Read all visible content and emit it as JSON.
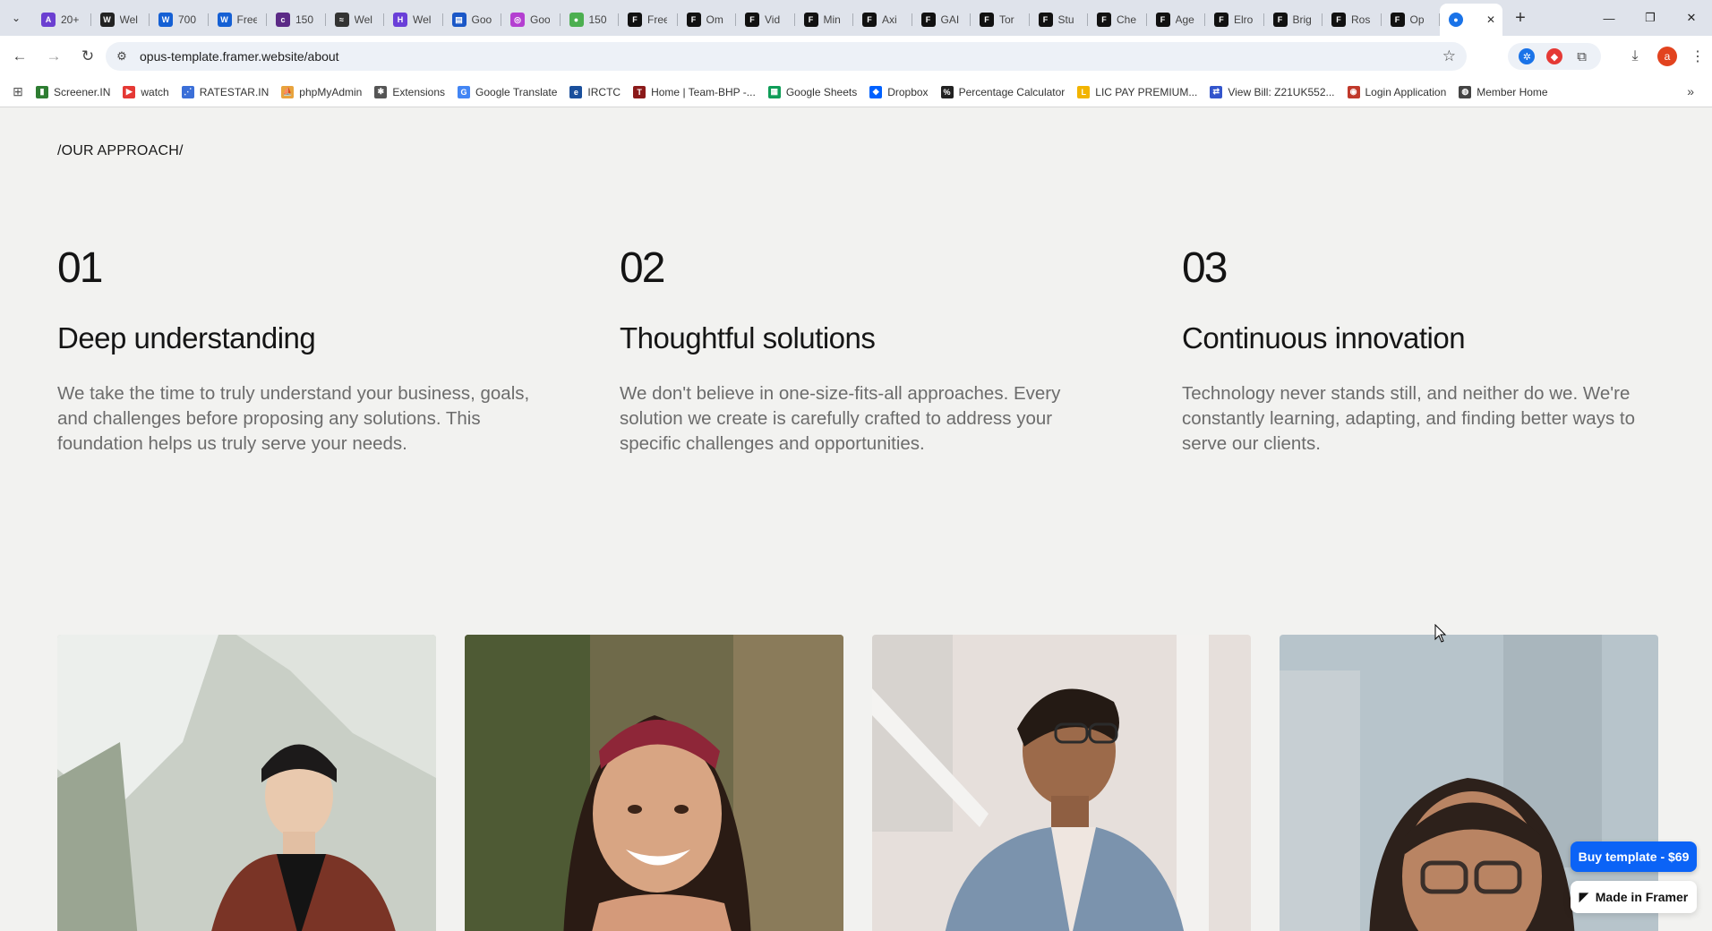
{
  "browser": {
    "tabs": [
      {
        "title": "20+",
        "color": "#6b3fd1",
        "glyph": "A"
      },
      {
        "title": "Wel",
        "color": "#222222",
        "glyph": "W"
      },
      {
        "title": "700",
        "color": "#1560d4",
        "glyph": "W"
      },
      {
        "title": "Free",
        "color": "#1560d4",
        "glyph": "W"
      },
      {
        "title": "150",
        "color": "#5b2a86",
        "glyph": "c"
      },
      {
        "title": "Wel",
        "color": "#333333",
        "glyph": "≈"
      },
      {
        "title": "Wel",
        "color": "#6a3fd8",
        "glyph": "H"
      },
      {
        "title": "Goo",
        "color": "#1a57c7",
        "glyph": "▤"
      },
      {
        "title": "Goo",
        "color": "#b43fd1",
        "glyph": "◎"
      },
      {
        "title": "150",
        "color": "#4caf50",
        "glyph": "●"
      },
      {
        "title": "Free",
        "color": "#111111",
        "glyph": "F"
      },
      {
        "title": "Om",
        "color": "#111111",
        "glyph": "F"
      },
      {
        "title": "Vid",
        "color": "#111111",
        "glyph": "F"
      },
      {
        "title": "Min",
        "color": "#111111",
        "glyph": "F"
      },
      {
        "title": "Axi",
        "color": "#111111",
        "glyph": "F"
      },
      {
        "title": "GAI",
        "color": "#111111",
        "glyph": "F"
      },
      {
        "title": "Tor",
        "color": "#111111",
        "glyph": "F"
      },
      {
        "title": "Stu",
        "color": "#111111",
        "glyph": "F"
      },
      {
        "title": "Che",
        "color": "#111111",
        "glyph": "F"
      },
      {
        "title": "Age",
        "color": "#111111",
        "glyph": "F"
      },
      {
        "title": "Elro",
        "color": "#111111",
        "glyph": "F"
      },
      {
        "title": "Brig",
        "color": "#111111",
        "glyph": "F"
      },
      {
        "title": "Ros",
        "color": "#111111",
        "glyph": "F"
      },
      {
        "title": "Op",
        "color": "#111111",
        "glyph": "F"
      }
    ],
    "active_tab": {
      "glyph": "●",
      "color": "#1a73e8"
    },
    "url": "opus-template.framer.website/about",
    "profile_initial": "a",
    "bookmarks": [
      {
        "label": "Screener.IN",
        "color": "#2e7d32",
        "glyph": "▮"
      },
      {
        "label": "watch",
        "color": "#e53935",
        "glyph": "▶"
      },
      {
        "label": "RATESTAR.IN",
        "color": "#3b6fd8",
        "glyph": "⋰"
      },
      {
        "label": "phpMyAdmin",
        "color": "#e8a33d",
        "glyph": "⛵"
      },
      {
        "label": "Extensions",
        "color": "#555555",
        "glyph": "✱"
      },
      {
        "label": "Google Translate",
        "color": "#4285f4",
        "glyph": "G"
      },
      {
        "label": "IRCTC",
        "color": "#1a4f9c",
        "glyph": "e"
      },
      {
        "label": "Home | Team-BHP -...",
        "color": "#8b1a1a",
        "glyph": "T"
      },
      {
        "label": "Google Sheets",
        "color": "#0f9d58",
        "glyph": "▦"
      },
      {
        "label": "Dropbox",
        "color": "#0061ff",
        "glyph": "◆"
      },
      {
        "label": "Percentage Calculator",
        "color": "#222222",
        "glyph": "%"
      },
      {
        "label": "LIC PAY PREMIUM...",
        "color": "#f2b400",
        "glyph": "L"
      },
      {
        "label": "View Bill: Z21UK552...",
        "color": "#3355cc",
        "glyph": "⇄"
      },
      {
        "label": "Login Application",
        "color": "#c0392b",
        "glyph": "◉"
      },
      {
        "label": "Member Home",
        "color": "#444444",
        "glyph": "◍"
      }
    ]
  },
  "page": {
    "section_label": "/OUR APPROACH/",
    "approaches": [
      {
        "number": "01",
        "heading": "Deep understanding",
        "description": "We take the time to truly understand your business, goals, and challenges before proposing any solutions. This foundation helps us truly serve your needs."
      },
      {
        "number": "02",
        "heading": "Thoughtful solutions",
        "description": "We don't believe in one-size-fits-all approaches. Every solution we create is carefully crafted to address your specific challenges and opportunities."
      },
      {
        "number": "03",
        "heading": "Continuous innovation",
        "description": "Technology never stands still, and neither do we. We're constantly learning, adapting, and finding better ways to serve our clients."
      }
    ],
    "buy_button": "Buy template - $69",
    "framer_badge": "Made in Framer"
  }
}
